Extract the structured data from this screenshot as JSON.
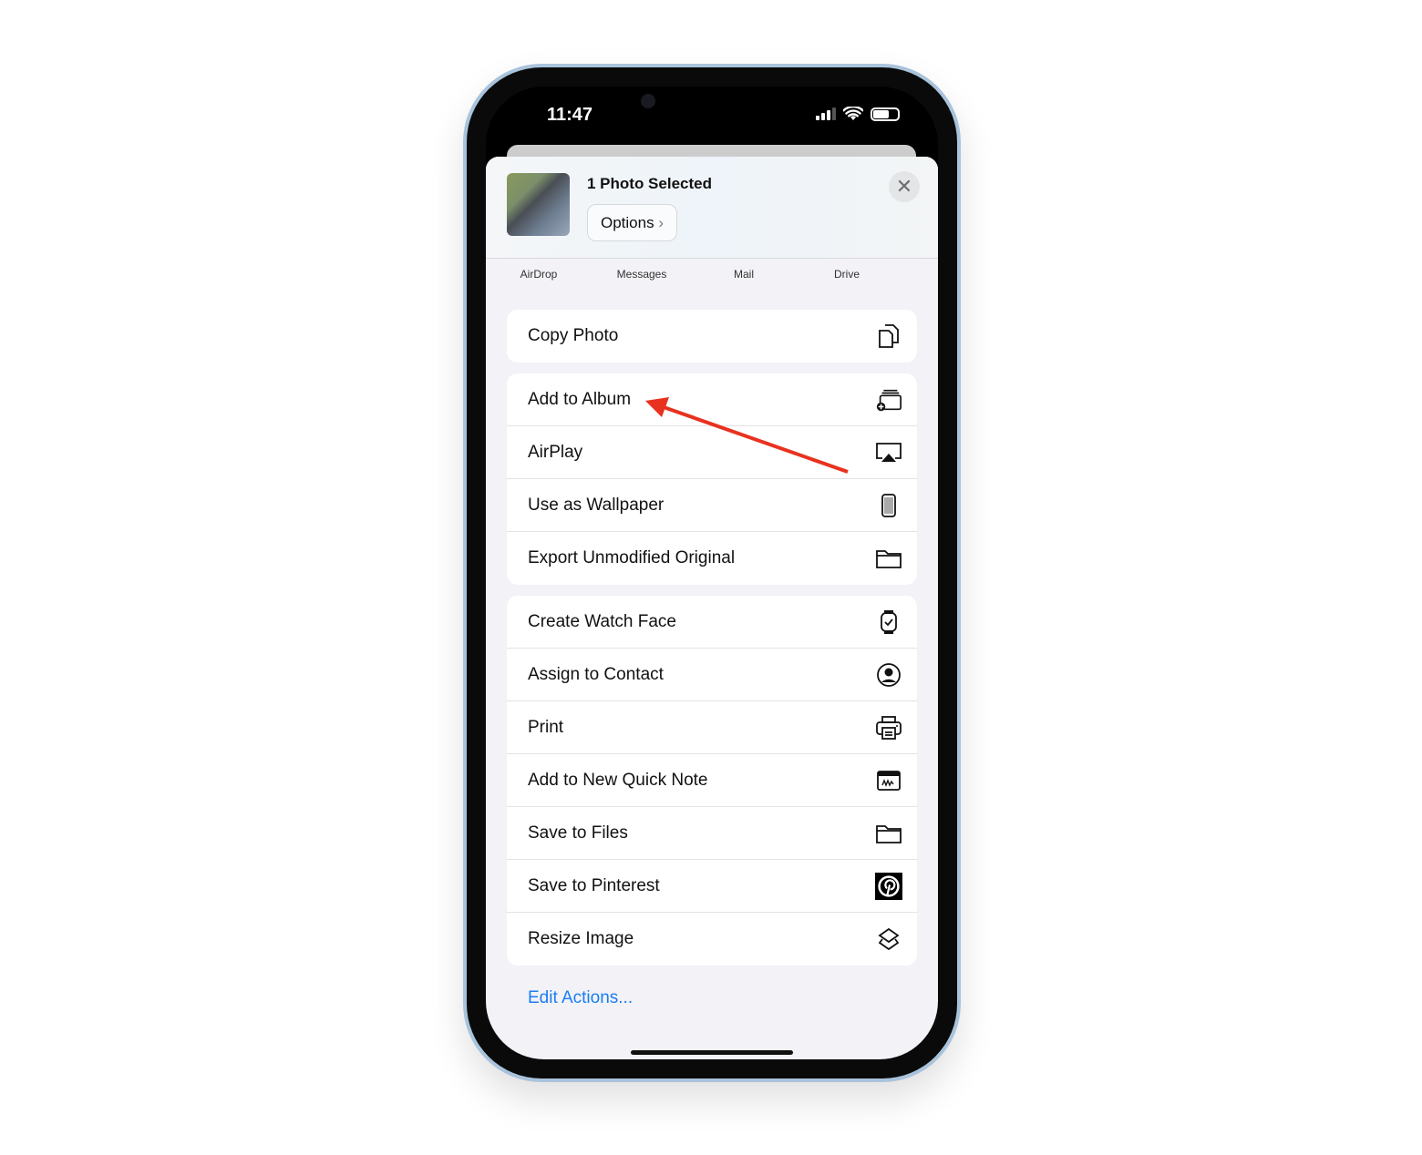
{
  "status_bar": {
    "time": "11:47"
  },
  "share_sheet": {
    "title": "1 Photo Selected",
    "options_label": "Options",
    "apps": [
      "AirDrop",
      "Messages",
      "Mail",
      "Drive"
    ],
    "groups": [
      [
        {
          "label": "Copy Photo",
          "icon": "copy-icon"
        }
      ],
      [
        {
          "label": "Add to Album",
          "icon": "add-to-album-icon"
        },
        {
          "label": "AirPlay",
          "icon": "airplay-icon"
        },
        {
          "label": "Use as Wallpaper",
          "icon": "phone-icon"
        },
        {
          "label": "Export Unmodified Original",
          "icon": "folder-icon"
        }
      ],
      [
        {
          "label": "Create Watch Face",
          "icon": "watch-icon"
        },
        {
          "label": "Assign to Contact",
          "icon": "contact-icon"
        },
        {
          "label": "Print",
          "icon": "printer-icon"
        },
        {
          "label": "Add to New Quick Note",
          "icon": "quick-note-icon"
        },
        {
          "label": "Save to Files",
          "icon": "folder-icon"
        },
        {
          "label": "Save to Pinterest",
          "icon": "pinterest-icon"
        },
        {
          "label": "Resize Image",
          "icon": "shortcuts-icon"
        }
      ]
    ],
    "edit_actions": "Edit Actions..."
  },
  "colors": {
    "accent": "#1a7ef2",
    "annotation_arrow": "#e8321f"
  }
}
